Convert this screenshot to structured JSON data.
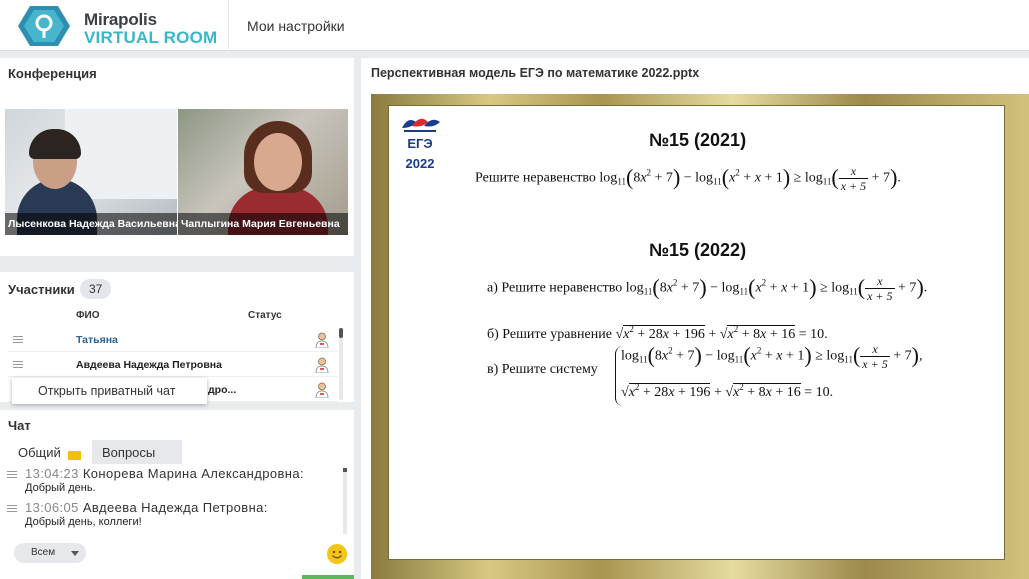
{
  "app": {
    "logo_line1": "Mirapolis",
    "logo_line2": "VIRTUAL ROOM",
    "header_title": "Мои настройки",
    "brand_color": "#38b7c9"
  },
  "conference": {
    "title": "Конференция",
    "videos": [
      {
        "caption": "Лысенкова Надежда  Васильевна"
      },
      {
        "caption": "Чаплыгина Мария Евгеньевна"
      }
    ]
  },
  "participants": {
    "title": "Участники",
    "count": "37",
    "col_name": "ФИО",
    "col_status": "Статус",
    "rows": [
      {
        "name": "Татьяна",
        "color": "#2a6496"
      },
      {
        "name": "Авдеева  Надежда  Петровна",
        "color": "#222222"
      },
      {
        "name": "дро...",
        "color": "#222222"
      }
    ],
    "context_menu_item": "Открыть приватный чат"
  },
  "chat": {
    "title": "Чат",
    "tab_general": "Общий",
    "tab_questions": "Вопросы",
    "messages": [
      {
        "time": "13:04:23",
        "author": "Конорева Марина  Александровна:",
        "text": "Добрый день."
      },
      {
        "time": "13:06:05",
        "author": "Авдеева  Надежда  Петровна:",
        "text": "Добрый день, коллеги!"
      }
    ],
    "send_to": "Всем"
  },
  "presentation": {
    "file_name": "Перспективная модель ЕГЭ по математике 2022.pptx",
    "slide": {
      "logo_text": "ЕГЭ",
      "logo_year": "2022",
      "heading_2021": "№15 (2021)",
      "task_2021_prefix": "Решите неравенство",
      "heading_2022": "№15 (2022)",
      "task_a_prefix": "а) Решите неравенство",
      "task_b_prefix": "б) Решите уравнение",
      "task_v_prefix": "в) Решите систему"
    }
  }
}
